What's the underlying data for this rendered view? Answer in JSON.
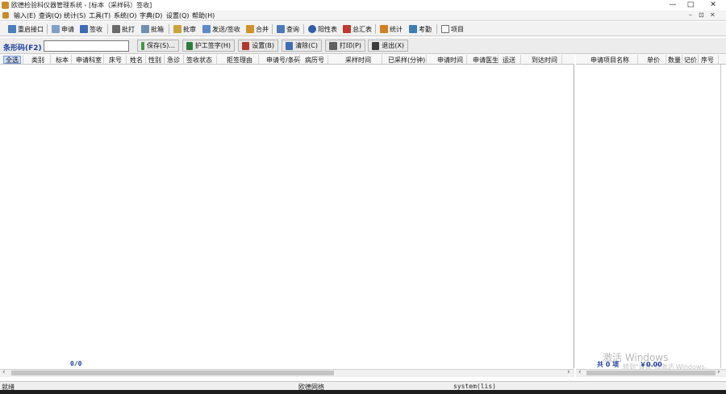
{
  "window": {
    "title": "欧德检验科仪器管理系统 - [标本（采样码）签收]",
    "controls": [
      "—",
      "□",
      "✕"
    ],
    "mdi_controls": [
      "–",
      "⊡",
      "✕"
    ]
  },
  "menu": {
    "items": [
      "输入(E)",
      "查询(Q)",
      "统计(S)",
      "工具(T)",
      "系统(O)",
      "字典(D)",
      "设置(Q)",
      "帮助(H)"
    ]
  },
  "toolbar": {
    "items": [
      {
        "label": "重启接口",
        "icon": "restart-icon",
        "color": "#4a7fc1"
      },
      {
        "label": "申请",
        "icon": "apply-icon",
        "color": "#7f9fc8"
      },
      {
        "label": "签收",
        "icon": "signin-icon",
        "color": "#3c6bb5"
      },
      {
        "label": "批打",
        "icon": "printer-icon",
        "color": "#6b6b6b"
      },
      {
        "label": "批箱",
        "icon": "box-icon",
        "color": "#6f8fb0"
      },
      {
        "label": "批审",
        "icon": "approve-icon",
        "color": "#c9a23a"
      },
      {
        "label": "发送/签收",
        "icon": "send-icon",
        "color": "#5e8bc8"
      },
      {
        "label": "合并",
        "icon": "merge-icon",
        "color": "#d1922c"
      },
      {
        "label": "查询",
        "icon": "search-icon",
        "color": "#4c7ab8"
      },
      {
        "label": "阳性表",
        "icon": "positive-icon",
        "color": "#2f5ea7"
      },
      {
        "label": "总汇表",
        "icon": "summary-icon",
        "color": "#c0392b"
      },
      {
        "label": "统计",
        "icon": "stats-icon",
        "color": "#d4801f"
      },
      {
        "label": "考勤",
        "icon": "attendance-icon",
        "color": "#3d7fb4"
      },
      {
        "label": "项目",
        "icon": "project-icon",
        "color": "#6d6d6d"
      }
    ]
  },
  "barcode": {
    "label": "条形码(F2)",
    "value": "",
    "buttons": [
      {
        "label": "保存(S)...",
        "icon": "save-icon",
        "color": "#3f9a3f"
      },
      {
        "label": "护工签字(H)",
        "icon": "sign-icon",
        "color": "#2e7c3a"
      },
      {
        "label": "设置(B)",
        "icon": "settings-icon",
        "color": "#b03a2e"
      },
      {
        "label": "清除(C)",
        "icon": "clear-icon",
        "color": "#3b6fb3"
      },
      {
        "label": "打印(P)",
        "icon": "print-icon",
        "color": "#606060"
      },
      {
        "label": "退出(X)",
        "icon": "exit-icon",
        "color": "#3d3d3d"
      }
    ]
  },
  "left_table": {
    "columns": [
      "全选",
      "类别",
      "标本",
      "申请科室",
      "床号",
      "姓名",
      "性别",
      "急诊",
      "签收状态",
      "拒签理由",
      "申请号/条码",
      "病历号",
      "采样时间",
      "已采样(分钟)",
      "申请时间",
      "申请医生",
      "运送",
      "到达时间"
    ],
    "rows": [],
    "count_text": "0/0"
  },
  "right_table": {
    "columns": [
      "申请项目名称",
      "单价",
      "数量",
      "记价",
      "序号"
    ],
    "rows": [],
    "total_count_text": "共 0 项",
    "total_amount_text": "￥0.00"
  },
  "watermark": {
    "title": "激活 Windows",
    "subtitle": "转到\"设置\"以激活 Windows。"
  },
  "status": {
    "left": "就绪",
    "middle": "欧德网络",
    "right": "system(lis)"
  }
}
